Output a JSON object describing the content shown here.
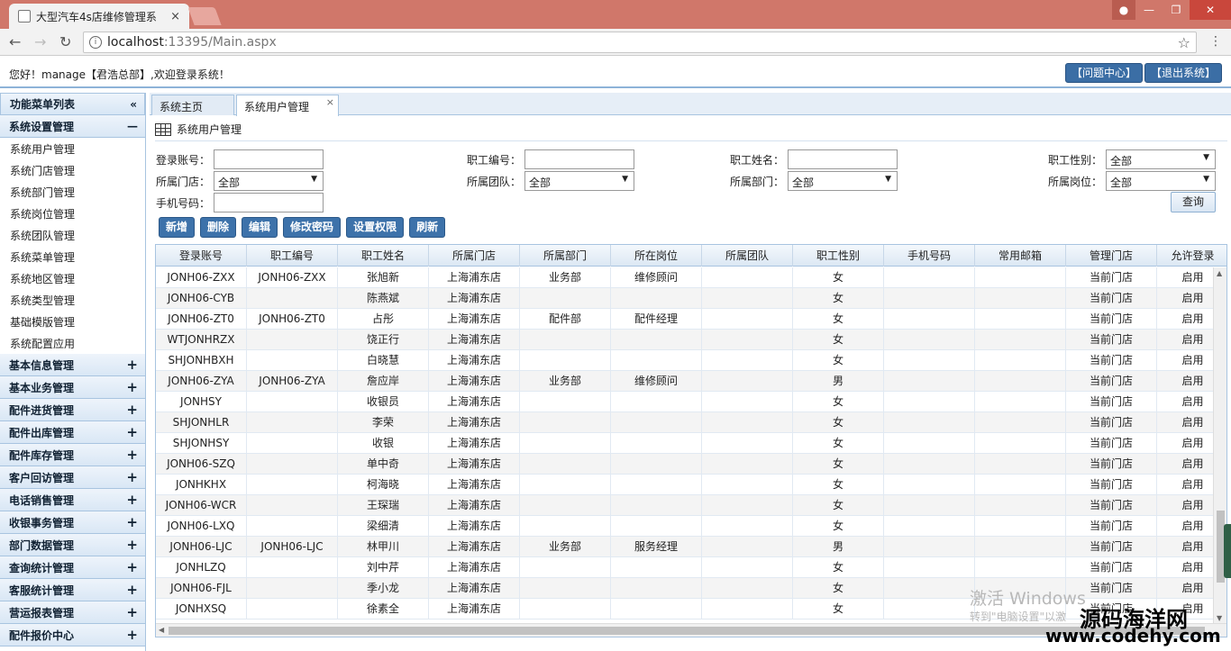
{
  "browser": {
    "tab_title": "大型汽车4s店维修管理系",
    "url_host": "localhost",
    "url_path": ":13395/Main.aspx"
  },
  "header": {
    "welcome": "您好！manage【君浩总部】,欢迎登录系统！",
    "help_button": "【问题中心】",
    "logout_button": "【退出系统】"
  },
  "sidebar": {
    "title": "功能菜单列表",
    "expanded_group": {
      "label": "系统设置管理",
      "items": [
        "系统用户管理",
        "系统门店管理",
        "系统部门管理",
        "系统岗位管理",
        "系统团队管理",
        "系统菜单管理",
        "系统地区管理",
        "系统类型管理",
        "基础模版管理",
        "系统配置应用"
      ]
    },
    "groups": [
      "基本信息管理",
      "基本业务管理",
      "配件进货管理",
      "配件出库管理",
      "配件库存管理",
      "客户回访管理",
      "电话销售管理",
      "收银事务管理",
      "部门数据管理",
      "查询统计管理",
      "客服统计管理",
      "营运报表管理",
      "配件报价中心"
    ]
  },
  "main": {
    "tabs": [
      {
        "label": "系统主页"
      },
      {
        "label": "系统用户管理"
      }
    ],
    "panel_title": "系统用户管理",
    "filters": {
      "login_account": "登录账号：",
      "employee_no": "职工编号：",
      "employee_name": "职工姓名：",
      "gender": "职工性别：",
      "gender_value": "全部",
      "store": "所属门店：",
      "store_value": "全部",
      "team": "所属团队：",
      "team_value": "全部",
      "department": "所属部门：",
      "department_value": "全部",
      "position": "所属岗位：",
      "position_value": "全部",
      "phone": "手机号码：",
      "query_button": "查询"
    },
    "actions": [
      "新增",
      "删除",
      "编辑",
      "修改密码",
      "设置权限",
      "刷新"
    ],
    "grid": {
      "columns": [
        "登录账号",
        "职工编号",
        "职工姓名",
        "所属门店",
        "所属部门",
        "所在岗位",
        "所属团队",
        "职工性别",
        "手机号码",
        "常用邮箱",
        "管理门店",
        "允许登录"
      ],
      "rows": [
        [
          "JONH06-ZXX",
          "JONH06-ZXX",
          "张旭新",
          "上海浦东店",
          "业务部",
          "维修顾问",
          "",
          "女",
          "",
          "",
          "当前门店",
          "启用"
        ],
        [
          "JONH06-CYB",
          "",
          "陈燕斌",
          "上海浦东店",
          "",
          "",
          "",
          "女",
          "",
          "",
          "当前门店",
          "启用"
        ],
        [
          "JONH06-ZT0",
          "JONH06-ZT0",
          "占彤",
          "上海浦东店",
          "配件部",
          "配件经理",
          "",
          "女",
          "",
          "",
          "当前门店",
          "启用"
        ],
        [
          "WTJONHRZX",
          "",
          "饶正行",
          "上海浦东店",
          "",
          "",
          "",
          "女",
          "",
          "",
          "当前门店",
          "启用"
        ],
        [
          "SHJONHBXH",
          "",
          "白晓慧",
          "上海浦东店",
          "",
          "",
          "",
          "女",
          "",
          "",
          "当前门店",
          "启用"
        ],
        [
          "JONH06-ZYA",
          "JONH06-ZYA",
          "詹应岸",
          "上海浦东店",
          "业务部",
          "维修顾问",
          "",
          "男",
          "",
          "",
          "当前门店",
          "启用"
        ],
        [
          "JONHSY",
          "",
          "收银员",
          "上海浦东店",
          "",
          "",
          "",
          "女",
          "",
          "",
          "当前门店",
          "启用"
        ],
        [
          "SHJONHLR",
          "",
          "李荣",
          "上海浦东店",
          "",
          "",
          "",
          "女",
          "",
          "",
          "当前门店",
          "启用"
        ],
        [
          "SHJONHSY",
          "",
          "收银",
          "上海浦东店",
          "",
          "",
          "",
          "女",
          "",
          "",
          "当前门店",
          "启用"
        ],
        [
          "JONH06-SZQ",
          "",
          "单中奇",
          "上海浦东店",
          "",
          "",
          "",
          "女",
          "",
          "",
          "当前门店",
          "启用"
        ],
        [
          "JONHKHX",
          "",
          "柯海晓",
          "上海浦东店",
          "",
          "",
          "",
          "女",
          "",
          "",
          "当前门店",
          "启用"
        ],
        [
          "JONH06-WCR",
          "",
          "王琛瑞",
          "上海浦东店",
          "",
          "",
          "",
          "女",
          "",
          "",
          "当前门店",
          "启用"
        ],
        [
          "JONH06-LXQ",
          "",
          "梁细清",
          "上海浦东店",
          "",
          "",
          "",
          "女",
          "",
          "",
          "当前门店",
          "启用"
        ],
        [
          "JONH06-LJC",
          "JONH06-LJC",
          "林甲川",
          "上海浦东店",
          "业务部",
          "服务经理",
          "",
          "男",
          "",
          "",
          "当前门店",
          "启用"
        ],
        [
          "JONHLZQ",
          "",
          "刘中芹",
          "上海浦东店",
          "",
          "",
          "",
          "女",
          "",
          "",
          "当前门店",
          "启用"
        ],
        [
          "JONH06-FJL",
          "",
          "季小龙",
          "上海浦东店",
          "",
          "",
          "",
          "女",
          "",
          "",
          "当前门店",
          "启用"
        ],
        [
          "JONHXSQ",
          "",
          "徐素全",
          "上海浦东店",
          "",
          "",
          "",
          "女",
          "",
          "",
          "当前门店",
          "启用"
        ]
      ]
    }
  },
  "overlay": {
    "activate1": "激活 Windows",
    "activate2": "转到\"电脑设置\"以激",
    "brand1": "源码海洋网",
    "brand2": "www.codehy.com"
  }
}
